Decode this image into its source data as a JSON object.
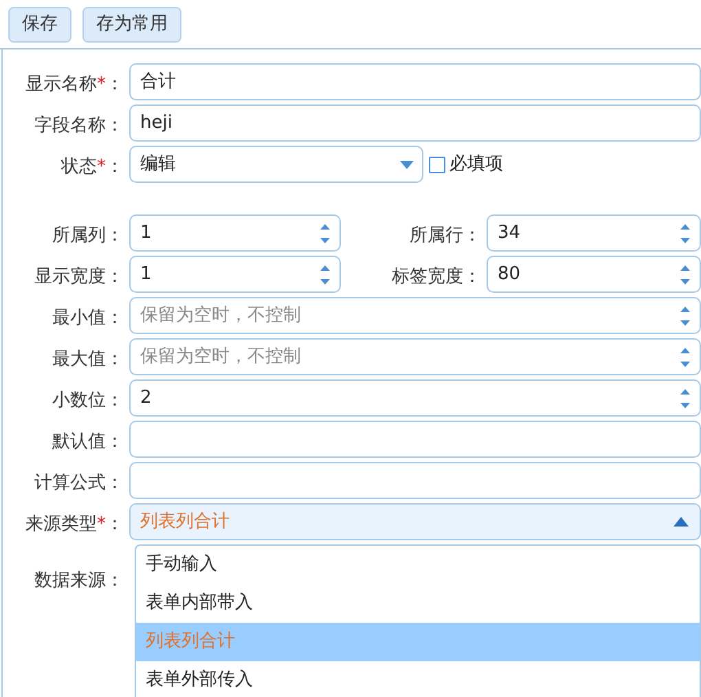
{
  "toolbar": [
    {
      "label": "保存"
    },
    {
      "label": "存为常用"
    }
  ],
  "groups": [
    [
      {
        "kind": "text",
        "label": "显示名称",
        "required_mark": "*",
        "suffix": "：",
        "value": "合计"
      },
      {
        "kind": "text",
        "label": "字段名称：",
        "value": "heji"
      },
      {
        "kind": "select",
        "label": "状态",
        "required_mark": "*",
        "suffix": "：",
        "value": "编辑",
        "checkbox": {
          "label": "必填项",
          "checked": false
        }
      }
    ],
    [
      {
        "kind": "pair",
        "items": [
          {
            "label": "所属列：",
            "value": "1"
          },
          {
            "label": "所属行：",
            "value": "34"
          }
        ]
      },
      {
        "kind": "pair",
        "items": [
          {
            "label": "显示宽度：",
            "value": "1"
          },
          {
            "label": "标签宽度：",
            "value": "80"
          }
        ]
      },
      {
        "kind": "spinner",
        "label": "最小值：",
        "placeholder": "保留为空时，不控制"
      },
      {
        "kind": "spinner",
        "label": "最大值：",
        "placeholder": "保留为空时，不控制"
      },
      {
        "kind": "spinner",
        "label": "小数位：",
        "value": "2"
      },
      {
        "kind": "text",
        "label": "默认值："
      },
      {
        "kind": "text",
        "label": "计算公式："
      },
      {
        "kind": "dropdown",
        "label": "来源类型",
        "required_mark": "*",
        "suffix": "：",
        "value": "列表列合计",
        "expanded": true,
        "options": [
          {
            "label": "手动输入",
            "selected": false
          },
          {
            "label": "表单内部带入",
            "selected": false
          },
          {
            "label": "列表列合计",
            "selected": true
          },
          {
            "label": "表单外部传入",
            "selected": false
          }
        ]
      },
      {
        "kind": "label_only",
        "label": "数据来源："
      }
    ]
  ]
}
